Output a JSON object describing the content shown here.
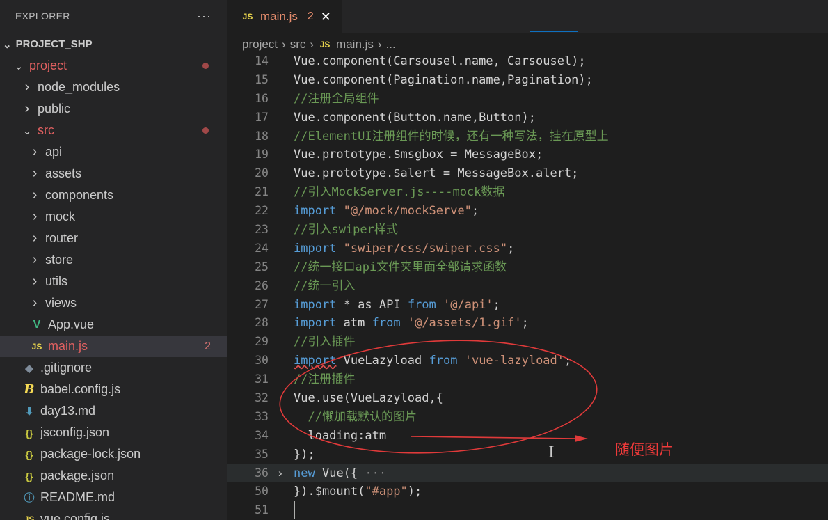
{
  "sidebar": {
    "header": "EXPLORER",
    "more": "···",
    "section": "PROJECT_SHP",
    "items": [
      {
        "label": "project",
        "type": "folder-open",
        "indent": 1,
        "red": true,
        "dot": true
      },
      {
        "label": "node_modules",
        "type": "folder",
        "indent": 2
      },
      {
        "label": "public",
        "type": "folder",
        "indent": 2
      },
      {
        "label": "src",
        "type": "folder-open",
        "indent": 2,
        "red": true,
        "dot": true
      },
      {
        "label": "api",
        "type": "folder",
        "indent": 3
      },
      {
        "label": "assets",
        "type": "folder",
        "indent": 3
      },
      {
        "label": "components",
        "type": "folder",
        "indent": 3
      },
      {
        "label": "mock",
        "type": "folder",
        "indent": 3
      },
      {
        "label": "router",
        "type": "folder",
        "indent": 3
      },
      {
        "label": "store",
        "type": "folder",
        "indent": 3
      },
      {
        "label": "utils",
        "type": "folder",
        "indent": 3
      },
      {
        "label": "views",
        "type": "folder",
        "indent": 3
      },
      {
        "label": "App.vue",
        "type": "vue",
        "indent": 3
      },
      {
        "label": "main.js",
        "type": "js",
        "indent": 3,
        "red": true,
        "active": true,
        "badge": "2"
      },
      {
        "label": ".gitignore",
        "type": "git",
        "indent": 2
      },
      {
        "label": "babel.config.js",
        "type": "babel",
        "indent": 2
      },
      {
        "label": "day13.md",
        "type": "md",
        "indent": 2
      },
      {
        "label": "jsconfig.json",
        "type": "json",
        "indent": 2
      },
      {
        "label": "package-lock.json",
        "type": "json",
        "indent": 2
      },
      {
        "label": "package.json",
        "type": "json",
        "indent": 2
      },
      {
        "label": "README.md",
        "type": "info",
        "indent": 2
      },
      {
        "label": "vue.config.js",
        "type": "js",
        "indent": 2
      }
    ]
  },
  "icons": {
    "js": "JS",
    "vue": "V",
    "git": "◆",
    "babel": "B",
    "md": "⬇",
    "json": "{}",
    "info": "ⓘ"
  },
  "tab": {
    "icon": "JS",
    "name": "main.js",
    "count": "2",
    "close": "✕"
  },
  "breadcrumb": {
    "parts": [
      "project",
      "src",
      "main.js",
      "..."
    ],
    "sep": "›"
  },
  "code": [
    {
      "n": "14",
      "html": "Vue.component(Carsousel.name, Carsousel);"
    },
    {
      "n": "15",
      "html": "Vue.component(Pagination.name,Pagination);"
    },
    {
      "n": "16",
      "cm": "//注册全局组件"
    },
    {
      "n": "17",
      "html": "Vue.component(Button.name,Button);"
    },
    {
      "n": "18",
      "cm": "//ElementUI注册组件的时候，还有一种写法，挂在原型上"
    },
    {
      "n": "19",
      "html": "Vue.prototype.$msgbox = MessageBox;"
    },
    {
      "n": "20",
      "html": "Vue.prototype.$alert = MessageBox.alert;"
    },
    {
      "n": "21",
      "cm": "//引入MockServer.js----mock数据"
    },
    {
      "n": "22",
      "kw": "import",
      "str": "\"@/mock/mockServe\"",
      "tail": ";"
    },
    {
      "n": "23",
      "cm": "//引入swiper样式"
    },
    {
      "n": "24",
      "kw": "import",
      "str": "\"swiper/css/swiper.css\"",
      "tail": ";"
    },
    {
      "n": "25",
      "cm": "//统一接口api文件夹里面全部请求函数"
    },
    {
      "n": "26",
      "cm": "//统一引入"
    },
    {
      "n": "27",
      "kw": "import",
      "mid": "* as API",
      "kw2": "from",
      "str": "'@/api'",
      "tail": ";"
    },
    {
      "n": "28",
      "kw": "import",
      "mid": "atm",
      "kw2": "from",
      "str": "'@/assets/1.gif'",
      "tail": ";"
    },
    {
      "n": "29",
      "cm": "//引入插件"
    },
    {
      "n": "30",
      "kw": "import",
      "mid": "VueLazyload",
      "kw2": "from",
      "str": "'vue-lazyload'",
      "tail": ";",
      "squiggle": true
    },
    {
      "n": "31",
      "cm": "//注册插件"
    },
    {
      "n": "32",
      "html": "Vue.use(VueLazyload,{"
    },
    {
      "n": "33",
      "cm": "  //懒加载默认的图片"
    },
    {
      "n": "34",
      "html": "  loading:atm"
    },
    {
      "n": "35",
      "html": "});"
    },
    {
      "n": "36",
      "fold": "›",
      "kw": "new",
      "mid": "Vue({",
      "ell": "···",
      "hl": true
    },
    {
      "n": "50",
      "html": "}).$mount(",
      "str": "\"#app\"",
      "tail": ");"
    },
    {
      "n": "51",
      "cursor": true
    }
  ],
  "annotation": {
    "text": "随便图片",
    "color": "#f03a3a"
  }
}
